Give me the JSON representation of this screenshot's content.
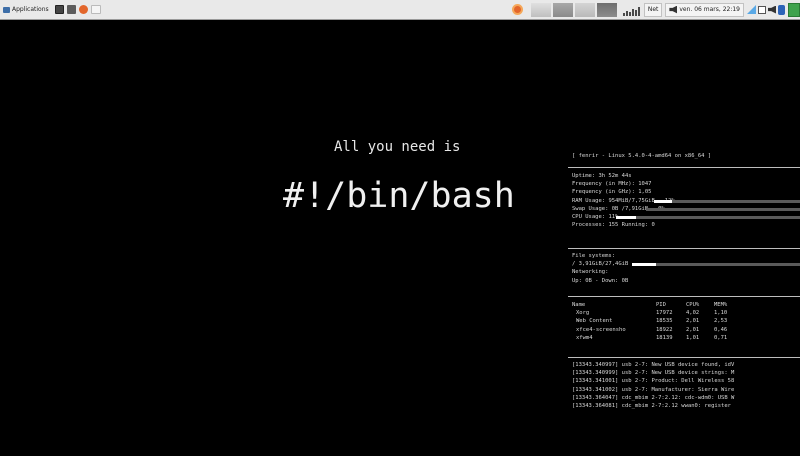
{
  "panel": {
    "applications_label": "Applications",
    "net_label": "Net",
    "clock": "ven. 06 mars, 22:19",
    "colors": {
      "panel_bg": "#e9e9e9",
      "firefox": "#e3662b",
      "user_chip": "#3fa34d"
    }
  },
  "desktop": {
    "tagline": "All you need is",
    "shebang": "#!/bin/bash"
  },
  "conky": {
    "header": "[ fenrir - Linux 5.4.0-4-amd64 on x86_64 ]",
    "system": [
      {
        "label": "Uptime:",
        "value": "3h 52m 44s"
      },
      {
        "label": "Frequency (in MHz):",
        "value": "1047"
      },
      {
        "label": "Frequency (in GHz):",
        "value": "1,05"
      },
      {
        "label": "RAM Usage:",
        "value": "954MiB/7,75GiB - 12%",
        "bar_percent": 12
      },
      {
        "label": "Swap Usage:",
        "value": "0B  /7,91GiB - 0%",
        "bar_percent": 0
      },
      {
        "label": "CPU Usage:",
        "value": "11%",
        "bar_percent": 11
      },
      {
        "label": "Processes:",
        "value": "155  Running: 0"
      }
    ],
    "filesystems": {
      "title": "File systems:",
      "root": "/ 3,91GiB/27,4GiB",
      "root_percent": 14,
      "networking_label": "Networking:",
      "net_line": "Up: 0B     - Down: 0B"
    },
    "processes": {
      "headers": [
        "Name",
        "PID",
        "CPU%",
        "MEM%"
      ],
      "rows": [
        [
          "Xorg",
          "17972",
          "4,02",
          "1,10"
        ],
        [
          "Web Content",
          "18535",
          "2,01",
          "2,53"
        ],
        [
          "xfce4-screensho",
          "18922",
          "2,01",
          "0,46"
        ],
        [
          "xfwm4",
          "18139",
          "1,01",
          "0,71"
        ]
      ]
    },
    "log": [
      "[13343.340997] usb 2-7: New USB device found, idV",
      "[13343.340999] usb 2-7: New USB device strings: M",
      "[13343.341001] usb 2-7: Product: Dell Wireless 58",
      "[13343.341002] usb 2-7: Manufacturer: Sierra Wire",
      "[13343.364047] cdc_mbim 2-7:2.12: cdc-wdm0: USB W",
      "[13343.364081] cdc_mbim 2-7:2.12 wwan0: register"
    ]
  }
}
